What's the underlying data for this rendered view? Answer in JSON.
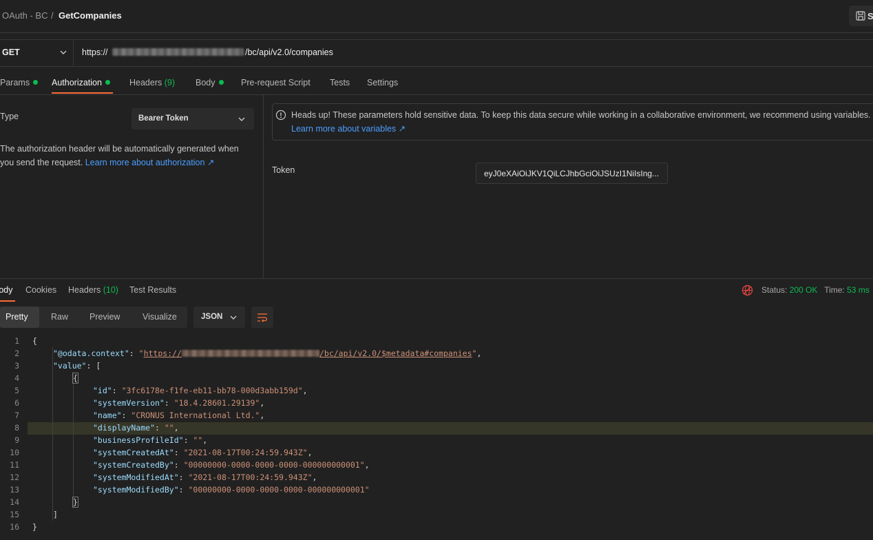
{
  "breadcrumb": {
    "parent": "OAuth - BC",
    "separator": "/",
    "current": "GetCompanies"
  },
  "header": {
    "save_label": "S"
  },
  "request": {
    "method": "GET",
    "url_prefix": "https://",
    "url_suffix": "/bc/api/v2.0/companies",
    "tabs": [
      {
        "label": "Params",
        "dot": true
      },
      {
        "label": "Authorization",
        "dot": true,
        "active": true
      },
      {
        "label": "Headers",
        "count": "(9)"
      },
      {
        "label": "Body",
        "dot": true
      },
      {
        "label": "Pre-request Script"
      },
      {
        "label": "Tests"
      },
      {
        "label": "Settings"
      }
    ]
  },
  "auth": {
    "type_label": "Type",
    "type_value": "Bearer Token",
    "desc_line1": "The authorization header will be automatically generated when",
    "desc_line2": "you send the request.",
    "desc_link": "Learn more about authorization ↗",
    "notice_text": "Heads up! These parameters hold sensitive data. To keep this data secure while working in a collaborative environment, we recommend using variables.",
    "notice_link": "Learn more about variables ↗",
    "token_label": "Token",
    "token_value": "eyJ0eXAiOiJKV1QiLCJhbGciOiJSUzI1NiIsIng..."
  },
  "response": {
    "tabs": [
      {
        "label": "Body",
        "active": true
      },
      {
        "label": "Cookies"
      },
      {
        "label": "Headers",
        "count": "(10)"
      },
      {
        "label": "Test Results"
      }
    ],
    "status_label": "Status:",
    "status_value": "200 OK",
    "time_label": "Time:",
    "time_value": "53 ms",
    "views": [
      "Pretty",
      "Raw",
      "Preview",
      "Visualize"
    ],
    "format": "JSON"
  },
  "code": {
    "line_numbers": [
      "1",
      "2",
      "3",
      "4",
      "5",
      "6",
      "7",
      "8",
      "9",
      "10",
      "11",
      "12",
      "13",
      "14",
      "15",
      "16"
    ],
    "context_key": "\"@odata.context\"",
    "context_prefix": "https://",
    "context_suffix": "/bc/api/v2.0/$metadata#companies",
    "value_key": "\"value\"",
    "fields": [
      {
        "key": "\"id\"",
        "value": "\"3fc6178e-f1fe-eb11-bb78-000d3abb159d\"",
        "comma": ","
      },
      {
        "key": "\"systemVersion\"",
        "value": "\"18.4.28601.29139\"",
        "comma": ","
      },
      {
        "key": "\"name\"",
        "value": "\"CRONUS International Ltd.\"",
        "comma": ","
      },
      {
        "key": "\"displayName\"",
        "value": "\"\"",
        "comma": ","
      },
      {
        "key": "\"businessProfileId\"",
        "value": "\"\"",
        "comma": ","
      },
      {
        "key": "\"systemCreatedAt\"",
        "value": "\"2021-08-17T00:24:59.943Z\"",
        "comma": ","
      },
      {
        "key": "\"systemCreatedBy\"",
        "value": "\"00000000-0000-0000-0000-000000000001\"",
        "comma": ","
      },
      {
        "key": "\"systemModifiedAt\"",
        "value": "\"2021-08-17T00:24:59.943Z\"",
        "comma": ","
      },
      {
        "key": "\"systemModifiedBy\"",
        "value": "\"00000000-0000-0000-0000-000000000001\"",
        "comma": ""
      }
    ]
  }
}
